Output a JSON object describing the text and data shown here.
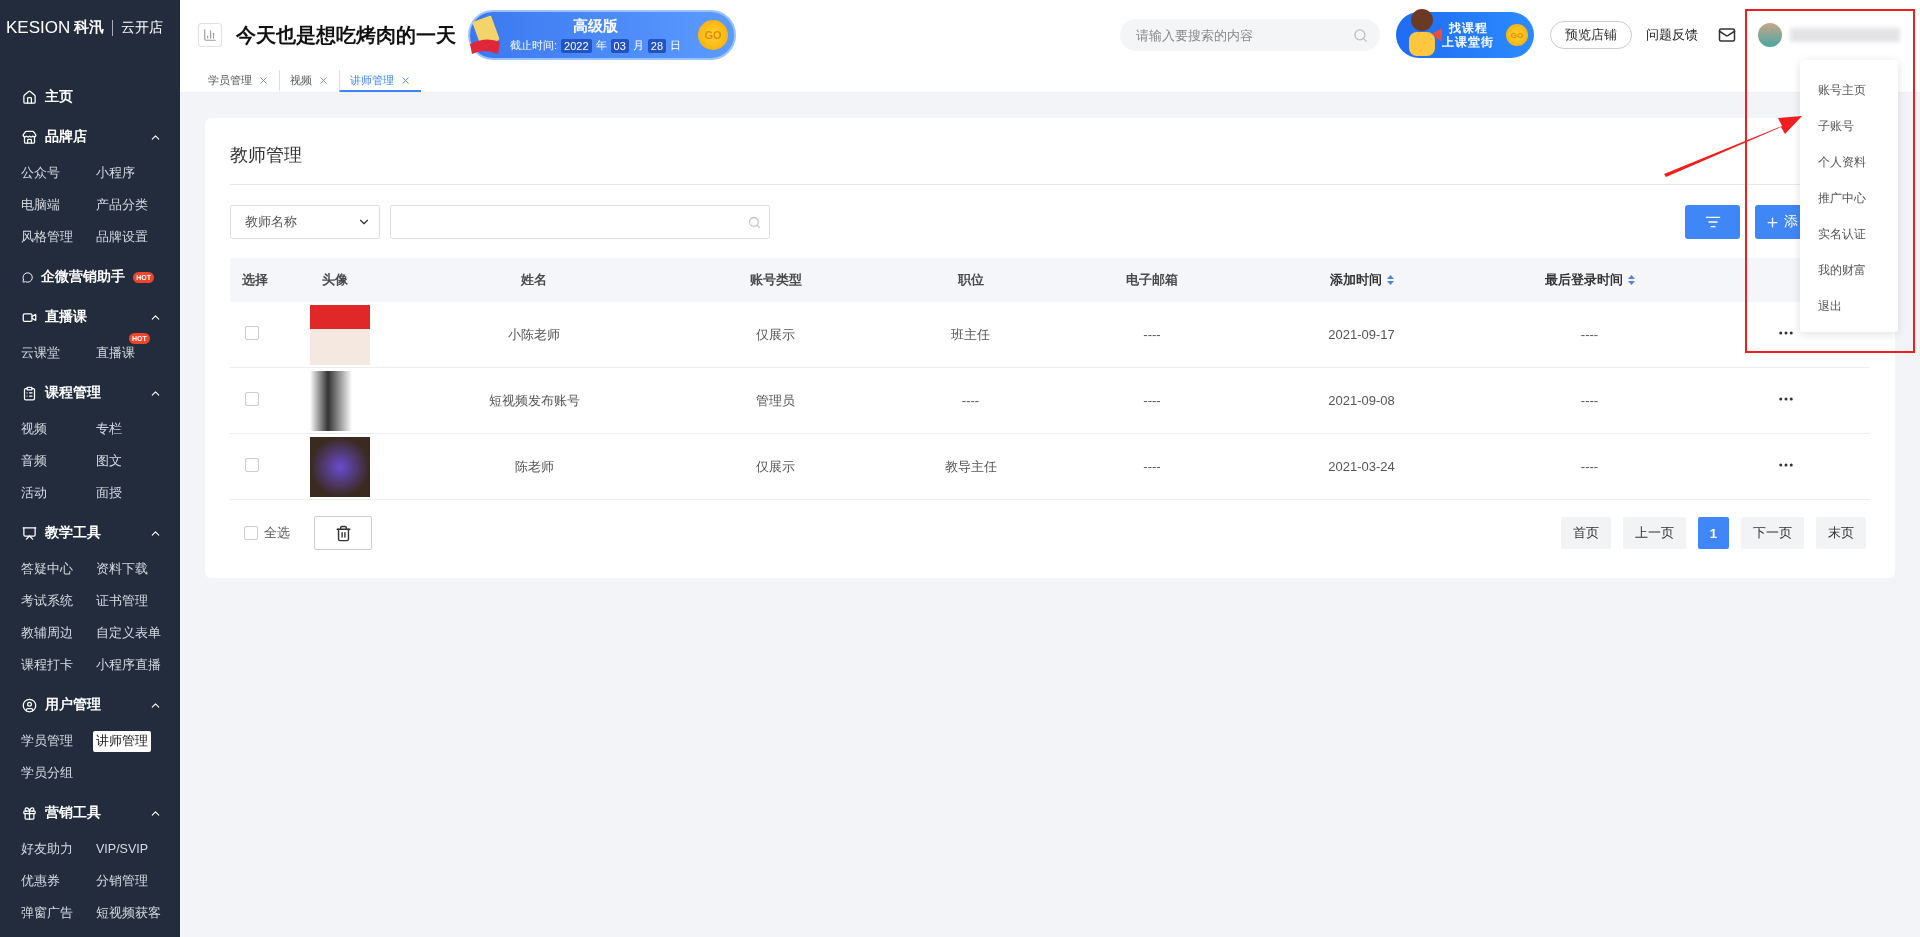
{
  "brand": {
    "logo": "KESION",
    "logo_cn": "科汛",
    "product": "云开店"
  },
  "header": {
    "store_title": "今天也是想吃烤肉的一天",
    "promo": {
      "edition": "高级版",
      "deadline_label": "截止时间:",
      "year": "2022",
      "year_unit": "年",
      "month": "03",
      "month_unit": "月",
      "day": "28",
      "day_unit": "日",
      "go": "GO"
    },
    "search": {
      "placeholder": "请输入要搜索的内容"
    },
    "course_banner": {
      "line1": "找课程",
      "line2": "上课堂街",
      "go": "GO"
    },
    "preview_button": "预览店铺",
    "feedback_link": "问题反馈"
  },
  "tabs": [
    {
      "label": "学员管理",
      "selected": false
    },
    {
      "label": "视频",
      "selected": false
    },
    {
      "label": "讲师管理",
      "selected": true
    }
  ],
  "sidebar": {
    "groups": [
      {
        "label": "主页"
      },
      {
        "label": "品牌店",
        "expanded": true,
        "items": [
          {
            "label": "公众号",
            "selected": false
          },
          {
            "label": "小程序",
            "selected": false
          },
          {
            "label": "电脑端",
            "selected": false
          },
          {
            "label": "产品分类",
            "selected": false
          },
          {
            "label": "风格管理",
            "selected": false
          },
          {
            "label": "品牌设置",
            "selected": false
          }
        ]
      },
      {
        "label": "企微营销助手",
        "badge": "HOT"
      },
      {
        "label": "直播课",
        "expanded": true,
        "items": [
          {
            "label": "云课堂",
            "selected": false
          },
          {
            "label": "直播课",
            "selected": false,
            "badge": "HOT"
          }
        ]
      },
      {
        "label": "课程管理",
        "expanded": true,
        "items": [
          {
            "label": "视频",
            "selected": false
          },
          {
            "label": "专栏",
            "selected": false
          },
          {
            "label": "音频",
            "selected": false
          },
          {
            "label": "图文",
            "selected": false
          },
          {
            "label": "活动",
            "selected": false
          },
          {
            "label": "面授",
            "selected": false
          }
        ]
      },
      {
        "label": "教学工具",
        "expanded": true,
        "items": [
          {
            "label": "答疑中心",
            "selected": false
          },
          {
            "label": "资料下载",
            "selected": false
          },
          {
            "label": "考试系统",
            "selected": false
          },
          {
            "label": "证书管理",
            "selected": false
          },
          {
            "label": "教辅周边",
            "selected": false
          },
          {
            "label": "自定义表单",
            "selected": false
          },
          {
            "label": "课程打卡",
            "selected": false
          },
          {
            "label": "小程序直播",
            "selected": false
          }
        ]
      },
      {
        "label": "用户管理",
        "expanded": true,
        "items": [
          {
            "label": "学员管理",
            "selected": false
          },
          {
            "label": "讲师管理",
            "selected": true
          },
          {
            "label": "学员分组",
            "selected": false
          }
        ]
      },
      {
        "label": "营销工具",
        "expanded": true,
        "items": [
          {
            "label": "好友助力",
            "selected": false
          },
          {
            "label": "VIP/SVIP",
            "selected": false
          },
          {
            "label": "优惠券",
            "selected": false
          },
          {
            "label": "分销管理",
            "selected": false
          },
          {
            "label": "弹窗广告",
            "selected": false
          },
          {
            "label": "短视频获客",
            "selected": false
          }
        ]
      }
    ]
  },
  "page": {
    "title": "教师管理",
    "filter_field": "教师名称",
    "add_button": "添",
    "table": {
      "columns": [
        {
          "label": "选择",
          "sortable": false
        },
        {
          "label": "头像",
          "sortable": false
        },
        {
          "label": "姓名",
          "sortable": false
        },
        {
          "label": "账号类型",
          "sortable": false
        },
        {
          "label": "职位",
          "sortable": false
        },
        {
          "label": "电子邮箱",
          "sortable": false
        },
        {
          "label": "添加时间",
          "sortable": true
        },
        {
          "label": "最后登录时间",
          "sortable": true
        }
      ],
      "rows": [
        {
          "checked": false,
          "name": "小陈老师",
          "account_type": "仅展示",
          "position": "班主任",
          "email": "----",
          "added": "2021-09-17",
          "last_login": "----"
        },
        {
          "checked": false,
          "name": "短视频发布账号",
          "account_type": "管理员",
          "position": "----",
          "email": "----",
          "added": "2021-09-08",
          "last_login": "----"
        },
        {
          "checked": false,
          "name": "陈老师",
          "account_type": "仅展示",
          "position": "教导主任",
          "email": "----",
          "added": "2021-03-24",
          "last_login": "----"
        }
      ]
    },
    "select_all": {
      "label": "全选",
      "checked": false
    },
    "pagination": [
      {
        "label": "首页",
        "selected": false
      },
      {
        "label": "上一页",
        "selected": false
      },
      {
        "label": "1",
        "selected": true
      },
      {
        "label": "下一页",
        "selected": false
      },
      {
        "label": "末页",
        "selected": false
      }
    ]
  },
  "account_menu": {
    "items": [
      "账号主页",
      "子账号",
      "个人资料",
      "推广中心",
      "实名认证",
      "我的财富",
      "退出"
    ]
  }
}
